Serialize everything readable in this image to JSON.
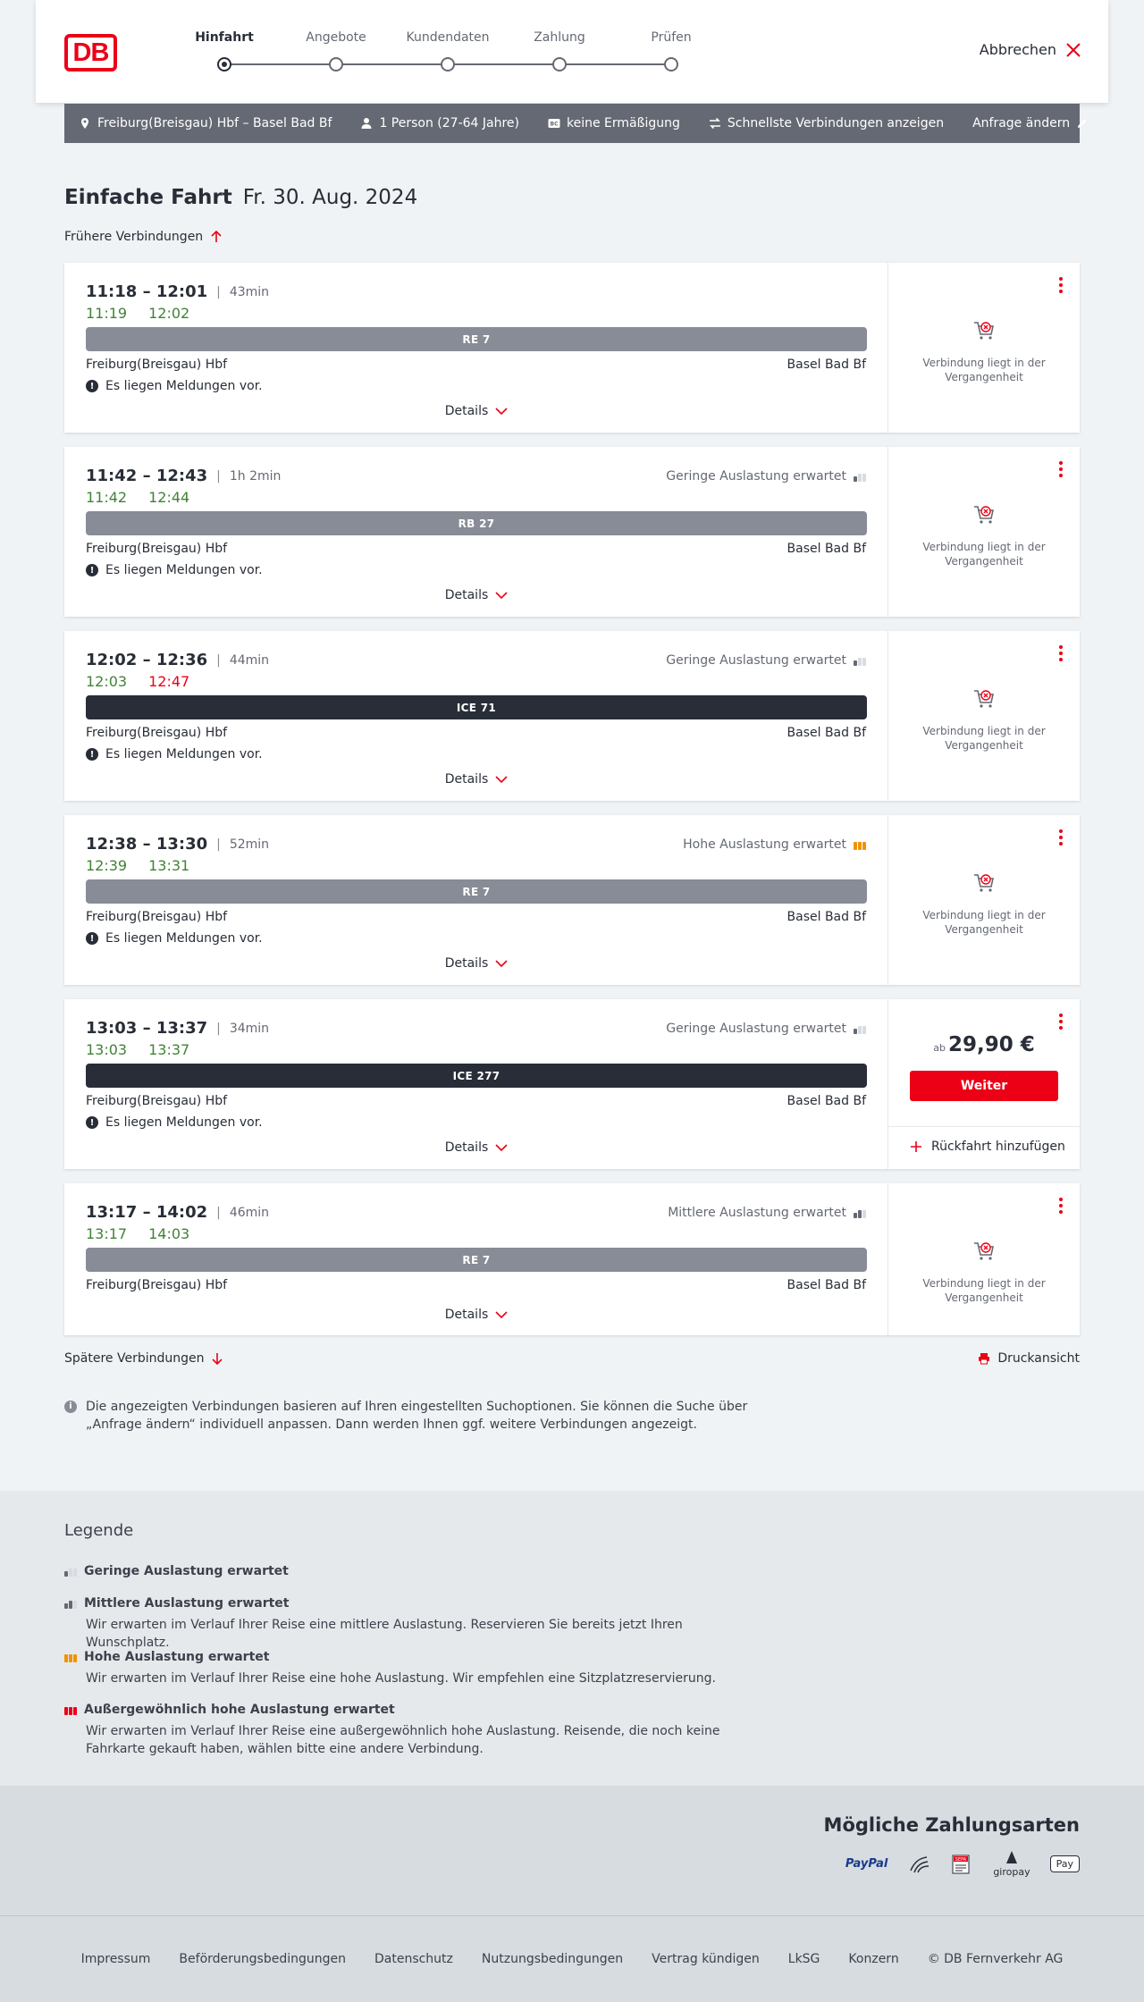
{
  "header": {
    "logo": "DB",
    "steps": [
      {
        "label": "Hinfahrt",
        "active": true
      },
      {
        "label": "Angebote",
        "active": false
      },
      {
        "label": "Kundendaten",
        "active": false
      },
      {
        "label": "Zahlung",
        "active": false
      },
      {
        "label": "Prüfen",
        "active": false
      }
    ],
    "cancel_label": "Abbrechen"
  },
  "summary": {
    "route": "Freiburg(Breisgau) Hbf – Basel Bad Bf",
    "passengers": "1 Person (27-64 Jahre)",
    "discount": "keine Ermäßigung",
    "fastest": "Schnellste Verbindungen anzeigen",
    "change": "Anfrage ändern"
  },
  "title": {
    "trip_type": "Einfache Fahrt",
    "date": "Fr. 30. Aug. 2024"
  },
  "earlier_label": "Frühere Verbindungen",
  "later_label": "Spätere Verbindungen",
  "print_label": "Druckansicht",
  "details_label": "Details",
  "notice_label": "Es liegen Meldungen vor.",
  "past_label": "Verbindung liegt in der Vergangenheit",
  "connections": [
    {
      "times": "11:18 – 12:01",
      "duration": "43min",
      "rt_dep": "11:19",
      "rt_arr": "12:02",
      "rt_arr_late": false,
      "occupancy": "",
      "occ_level": 0,
      "train": "RE 7",
      "ice": false,
      "from": "Freiburg(Breisgau) Hbf",
      "to": "Basel Bad Bf",
      "notice": true,
      "bookable": false
    },
    {
      "times": "11:42 – 12:43",
      "duration": "1h 2min",
      "rt_dep": "11:42",
      "rt_arr": "12:44",
      "rt_arr_late": false,
      "occupancy": "Geringe Auslastung erwartet",
      "occ_level": 1,
      "train": "RB 27",
      "ice": false,
      "from": "Freiburg(Breisgau) Hbf",
      "to": "Basel Bad Bf",
      "notice": true,
      "bookable": false
    },
    {
      "times": "12:02 – 12:36",
      "duration": "44min",
      "rt_dep": "12:03",
      "rt_arr": "12:47",
      "rt_arr_late": true,
      "occupancy": "Geringe Auslastung erwartet",
      "occ_level": 1,
      "train": "ICE 71",
      "ice": true,
      "from": "Freiburg(Breisgau) Hbf",
      "to": "Basel Bad Bf",
      "notice": true,
      "bookable": false
    },
    {
      "times": "12:38 – 13:30",
      "duration": "52min",
      "rt_dep": "12:39",
      "rt_arr": "13:31",
      "rt_arr_late": false,
      "occupancy": "Hohe Auslastung erwartet",
      "occ_level": 3,
      "train": "RE 7",
      "ice": false,
      "from": "Freiburg(Breisgau) Hbf",
      "to": "Basel Bad Bf",
      "notice": true,
      "bookable": false
    },
    {
      "times": "13:03 – 13:37",
      "duration": "34min",
      "rt_dep": "13:03",
      "rt_arr": "13:37",
      "rt_arr_late": false,
      "occupancy": "Geringe Auslastung erwartet",
      "occ_level": 1,
      "train": "ICE 277",
      "ice": true,
      "from": "Freiburg(Breisgau) Hbf",
      "to": "Basel Bad Bf",
      "notice": true,
      "bookable": true,
      "price_prefix": "ab",
      "price": "29,90 €",
      "button": "Weiter",
      "return_label": "Rückfahrt hinzufügen"
    },
    {
      "times": "13:17 – 14:02",
      "duration": "46min",
      "rt_dep": "13:17",
      "rt_arr": "14:03",
      "rt_arr_late": false,
      "occupancy": "Mittlere Auslastung erwartet",
      "occ_level": 2,
      "train": "RE 7",
      "ice": false,
      "from": "Freiburg(Breisgau) Hbf",
      "to": "Basel Bad Bf",
      "notice": false,
      "bookable": false
    }
  ],
  "info_text": "Die angezeigten Verbindungen basieren auf Ihren eingestellten Suchoptionen. Sie können die Suche über „Anfrage ändern“ individuell anpassen. Dann werden Ihnen ggf. weitere Verbindungen angezeigt.",
  "legend": {
    "title": "Legende",
    "items": [
      {
        "title": "Geringe Auslastung erwartet",
        "desc": ""
      },
      {
        "title": "Mittlere Auslastung erwartet",
        "desc": "Wir erwarten im Verlauf Ihrer Reise eine mittlere Auslastung. Reservieren Sie bereits jetzt Ihren Wunschplatz."
      },
      {
        "title": "Hohe Auslastung erwartet",
        "desc": "Wir erwarten im Verlauf Ihrer Reise eine hohe Auslastung. Wir empfehlen eine Sitzplatzreservierung."
      },
      {
        "title": "Außergewöhnlich hohe Auslastung erwartet",
        "desc": "Wir erwarten im Verlauf Ihrer Reise eine außergewöhnlich hohe Auslastung. Reisende, die noch keine Fahrkarte gekauft haben, wählen bitte eine andere Verbindung."
      }
    ]
  },
  "payment": {
    "title": "Mögliche Zahlungsarten",
    "methods": [
      "PayPal",
      "",
      "SEPA",
      "giropay",
      "Pay"
    ]
  },
  "footer": {
    "links": [
      "Impressum",
      "Beförderungsbedingungen",
      "Datenschutz",
      "Nutzungsbedingungen",
      "Vertrag kündigen",
      "LkSG",
      "Konzern",
      "© DB Fernverkehr AG"
    ]
  },
  "colors": {
    "brand": "#ec0016",
    "on_time": "#408335",
    "high_occupancy": "#f39200",
    "regional_train": "#878c96",
    "ice_train": "#282d37"
  }
}
